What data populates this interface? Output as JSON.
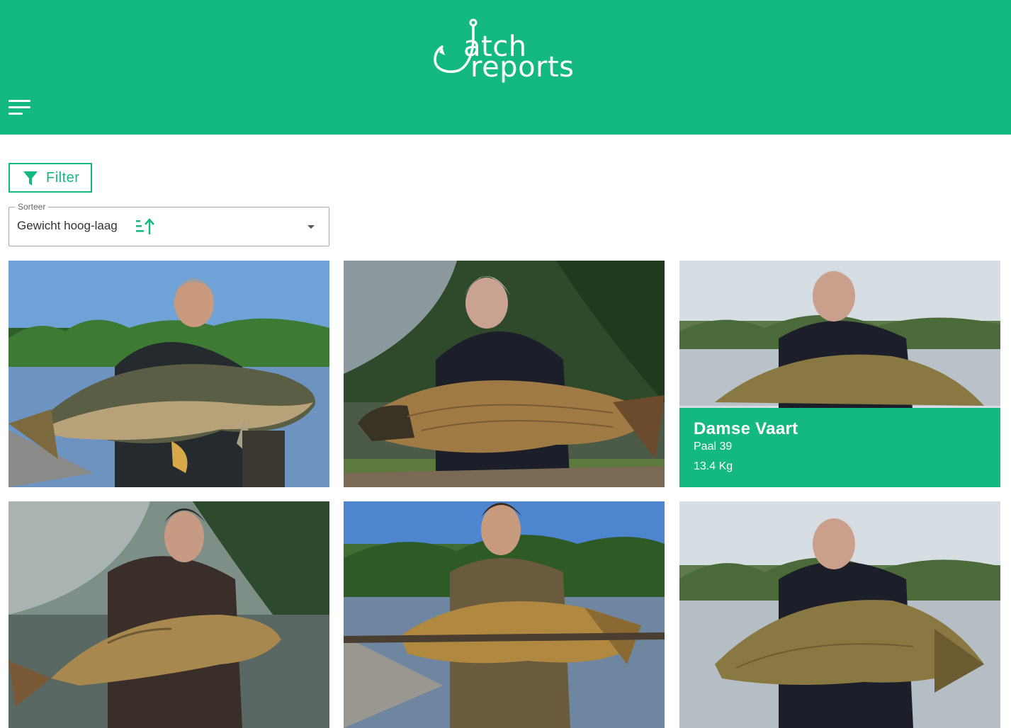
{
  "brand": {
    "line1": "atch",
    "line2": "reports",
    "color": "#13b97f"
  },
  "nav": {
    "menu_icon": "hamburger-menu-icon"
  },
  "toolbar": {
    "filter_label": "Filter",
    "filter_icon": "funnel-icon"
  },
  "sort": {
    "legend": "Sorteer",
    "value": "Gewicht hoog-laag",
    "icon": "sort-descending-icon"
  },
  "catches": [
    {
      "scene": "mirror-carp-lake-blue-sky"
    },
    {
      "scene": "common-carp-dark-trees"
    },
    {
      "scene": "common-carp-pale-lake",
      "hovered": true,
      "title": "Damse Vaart",
      "spot": "Paal 39",
      "weight": "13.4 Kg"
    },
    {
      "scene": "mirror-carp-misty"
    },
    {
      "scene": "common-carp-sunny-lake"
    },
    {
      "scene": "common-carp-pale-lake-2"
    }
  ]
}
